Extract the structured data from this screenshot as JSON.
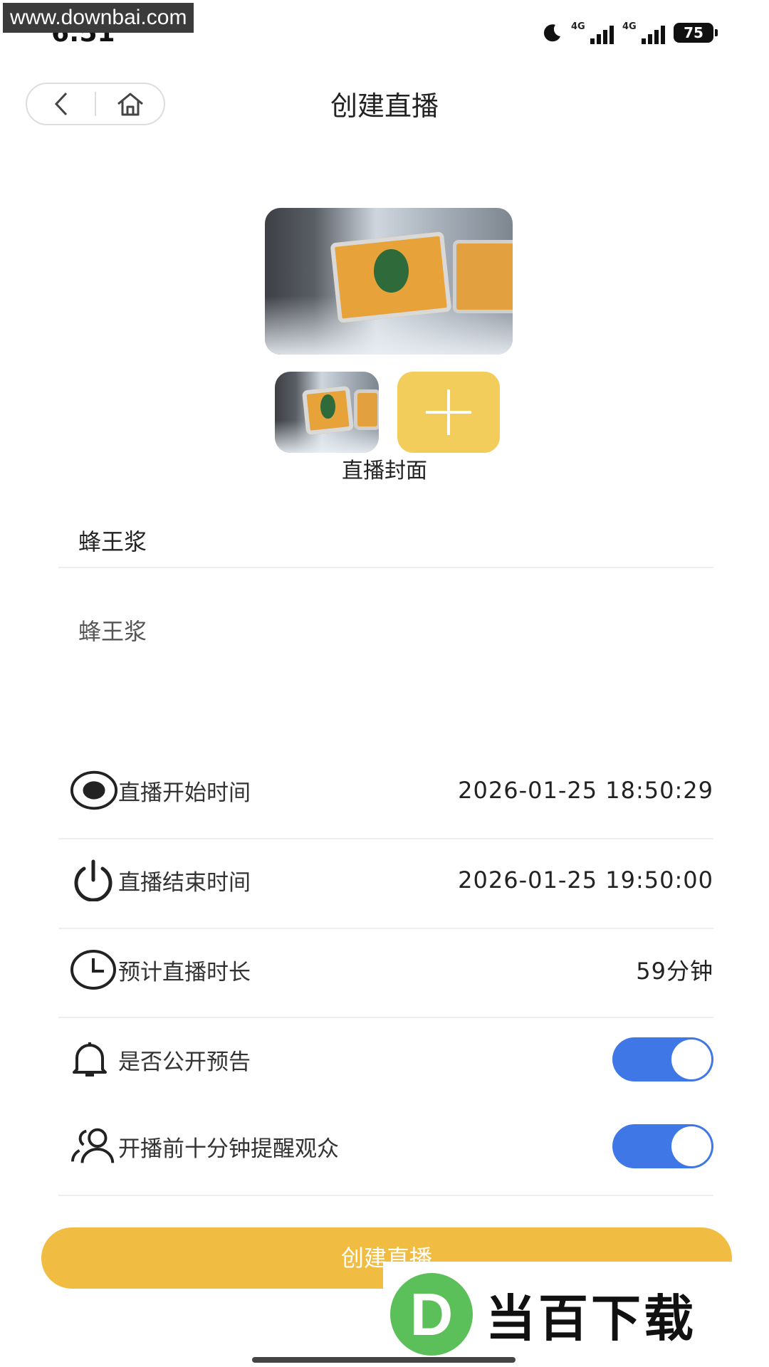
{
  "status_bar": {
    "time": "6:51",
    "dots": "···",
    "network_1": "4G",
    "network_2": "4G",
    "battery": "75"
  },
  "watermark": {
    "top_text": "www.downbai.com",
    "bottom_logo_letter": "D",
    "bottom_text": "当百下载"
  },
  "header": {
    "title": "创建直播"
  },
  "cover": {
    "label": "直播封面"
  },
  "form": {
    "title_value": "蜂王浆",
    "description_value": "蜂王浆",
    "rows": [
      {
        "label": "直播开始时间",
        "value": "2026-01-25 18:50:29",
        "icon": "record-icon"
      },
      {
        "label": "直播结束时间",
        "value": "2026-01-25 19:50:00",
        "icon": "power-icon"
      },
      {
        "label": "预计直播时长",
        "value": "59分钟",
        "icon": "clock-icon"
      },
      {
        "label": "是否公开预告",
        "toggle": true,
        "icon": "bell-icon"
      },
      {
        "label": "开播前十分钟提醒观众",
        "toggle": true,
        "icon": "users-icon"
      }
    ]
  },
  "actions": {
    "create_label": "创建直播"
  },
  "colors": {
    "accent_yellow": "#f0bc42",
    "toggle_blue": "#3f78e6",
    "add_tile": "#f3cd5c"
  }
}
